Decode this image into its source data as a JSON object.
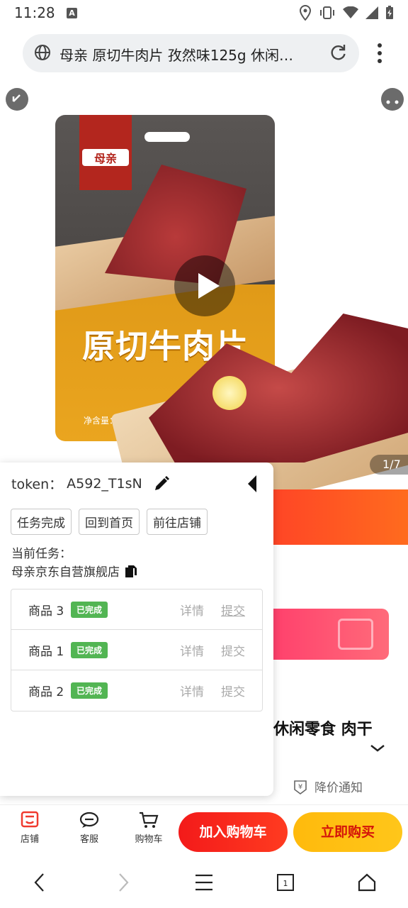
{
  "status_bar": {
    "time": "11:28",
    "notif_icon": "A"
  },
  "browser": {
    "url": "母亲 原切牛肉片 孜然味125g 休闲…"
  },
  "hero": {
    "package_title": "原切牛肉片",
    "package_brand": "母亲",
    "package_weight": "净含量：125g",
    "image_counter": "1/7"
  },
  "panel": {
    "token_label": "token：",
    "token_value": "A592_T1sN",
    "buttons": [
      "任务完成",
      "回到首页",
      "前往店铺"
    ],
    "current_task_label": "当前任务：",
    "current_task_value": "母亲京东自营旗舰店",
    "rows": [
      {
        "name": "商品 3",
        "status": "已完成",
        "detail": "详情",
        "submit": "提交"
      },
      {
        "name": "商品 1",
        "status": "已完成",
        "detail": "详情",
        "submit": "提交"
      },
      {
        "name": "商品 2",
        "status": "已完成",
        "detail": "详情",
        "submit": "提交"
      }
    ],
    "status_color": "#52b553"
  },
  "page": {
    "product_name_tail": "休闲零食 肉干",
    "price_alert": "降价通知"
  },
  "bottom_bar": {
    "shop": "店铺",
    "service": "客服",
    "cart": "购物车",
    "add_cart": "加入购物车",
    "buy_now": "立即购买"
  },
  "colors": {
    "accent_red": "#f31a1a",
    "accent_yellow": "#ffba0c"
  }
}
